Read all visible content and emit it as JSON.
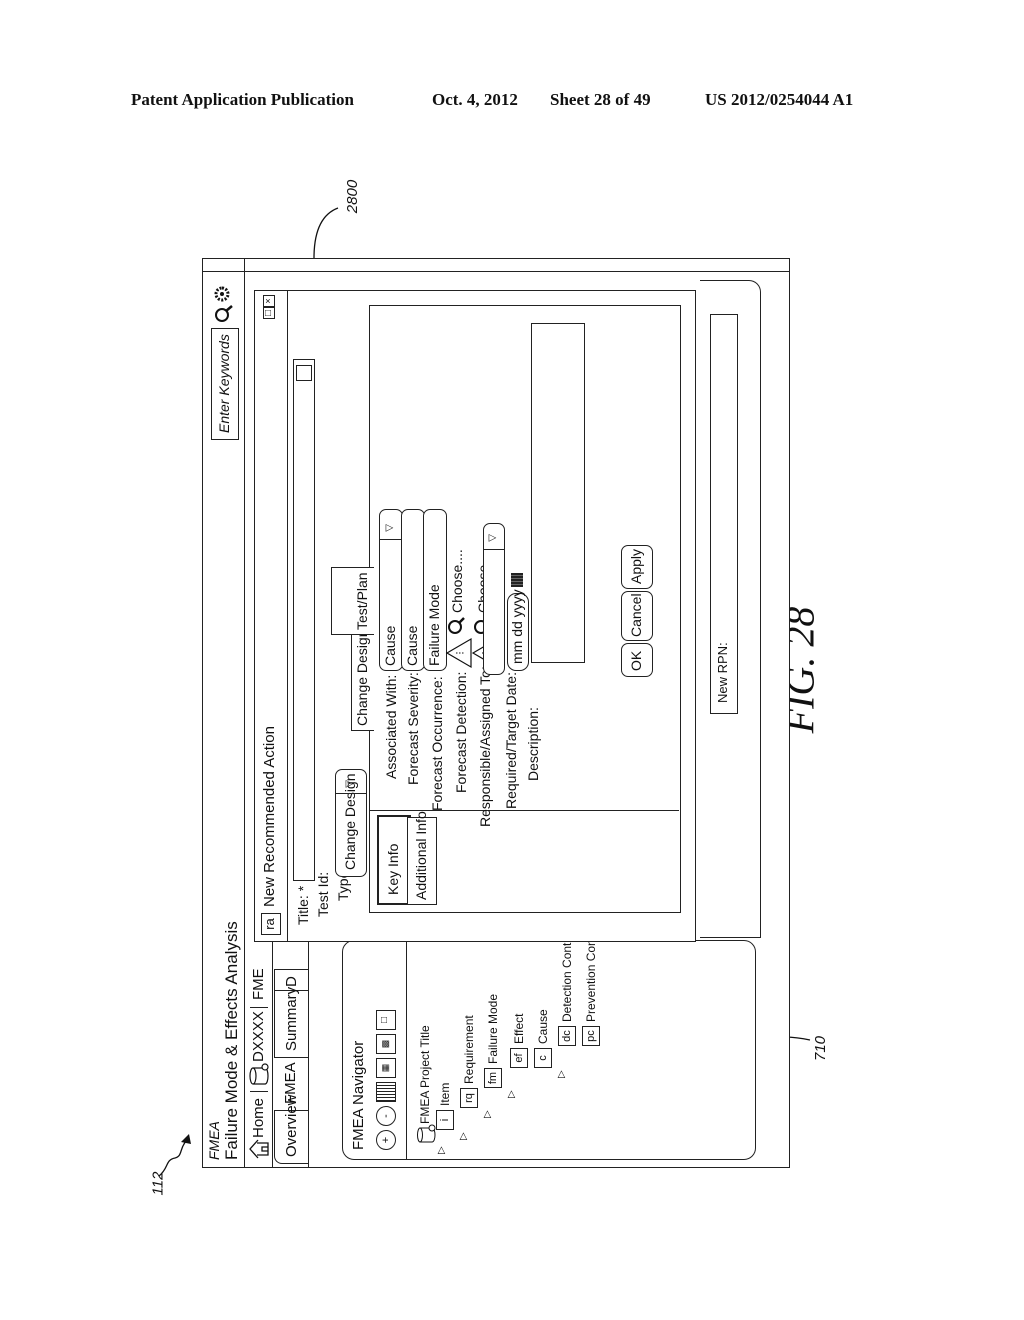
{
  "header": {
    "left": "Patent Application Publication",
    "date": "Oct. 4, 2012",
    "sheet": "Sheet 28 of 49",
    "number": "US 2012/0254044 A1"
  },
  "refs": {
    "figure_ref": "2800",
    "app_ref": "112",
    "navigator_ref": "710"
  },
  "figure_caption": "FIG. 28",
  "app": {
    "name": "FMEA",
    "title": "Failure Mode & Effects Analysis",
    "search_placeholder": "Enter Keywords",
    "nav": {
      "home": "Home",
      "project": "DXXXX",
      "fme": "FME"
    },
    "tabs": [
      "Overview",
      "FMEA",
      "Summary",
      "D"
    ],
    "navigator": {
      "title": "FMEA Navigator",
      "toolbar_icons": [
        "expand-icon",
        "collapse-icon",
        "list-icon",
        "chart-icon",
        "export-icon",
        "copy-icon"
      ],
      "tree": [
        {
          "label": "FMEA Project Title",
          "badge": "",
          "level": 0
        },
        {
          "label": "Item",
          "badge": "i",
          "level": 1
        },
        {
          "label": "Requirement",
          "badge": "rq",
          "level": 2
        },
        {
          "label": "Failure Mode",
          "badge": "fm",
          "level": 3
        },
        {
          "label": "Effect",
          "badge": "ef",
          "level": 4
        },
        {
          "label": "Cause",
          "badge": "c",
          "level": 4
        },
        {
          "label": "Detection Control",
          "badge": "dc",
          "level": 5
        },
        {
          "label": "Prevention Control",
          "badge": "pc",
          "level": 5
        }
      ]
    }
  },
  "dialog": {
    "badge": "ra",
    "title": "New Recommended Action",
    "fields": {
      "title_label": "Title: *",
      "test_id_label": "Test Id:",
      "type_label": "Type:",
      "type_value": "Change Design"
    },
    "side_tabs": [
      "Key Info",
      "Additional Info"
    ],
    "inner_tabs": [
      "Change Design",
      "Test/Plan"
    ],
    "form": {
      "associated_with_label": "Associated With:",
      "associated_with_value": "Cause",
      "forecast_severity_label": "Forecast Severity:",
      "forecast_severity_value": "Cause",
      "forecast_occurrence_label": "Forecast Occurrence:",
      "failure_mode_value": "Failure Mode",
      "choose_occurrence": "Choose....",
      "forecast_detection_label": "Forecast Detection:",
      "choose_detection": "Choose....",
      "responsible_label": "Responsible/Assigned To:",
      "responsible_value": "",
      "date_label": "Required/Target Date:",
      "date_placeholder": "mm dd yyyy",
      "description_label": "Description:",
      "description_value": ""
    },
    "buttons": {
      "ok": "OK",
      "cancel": "Cancel",
      "apply": "Apply"
    }
  },
  "status": {
    "new_rpn_label": "New RPN:"
  }
}
